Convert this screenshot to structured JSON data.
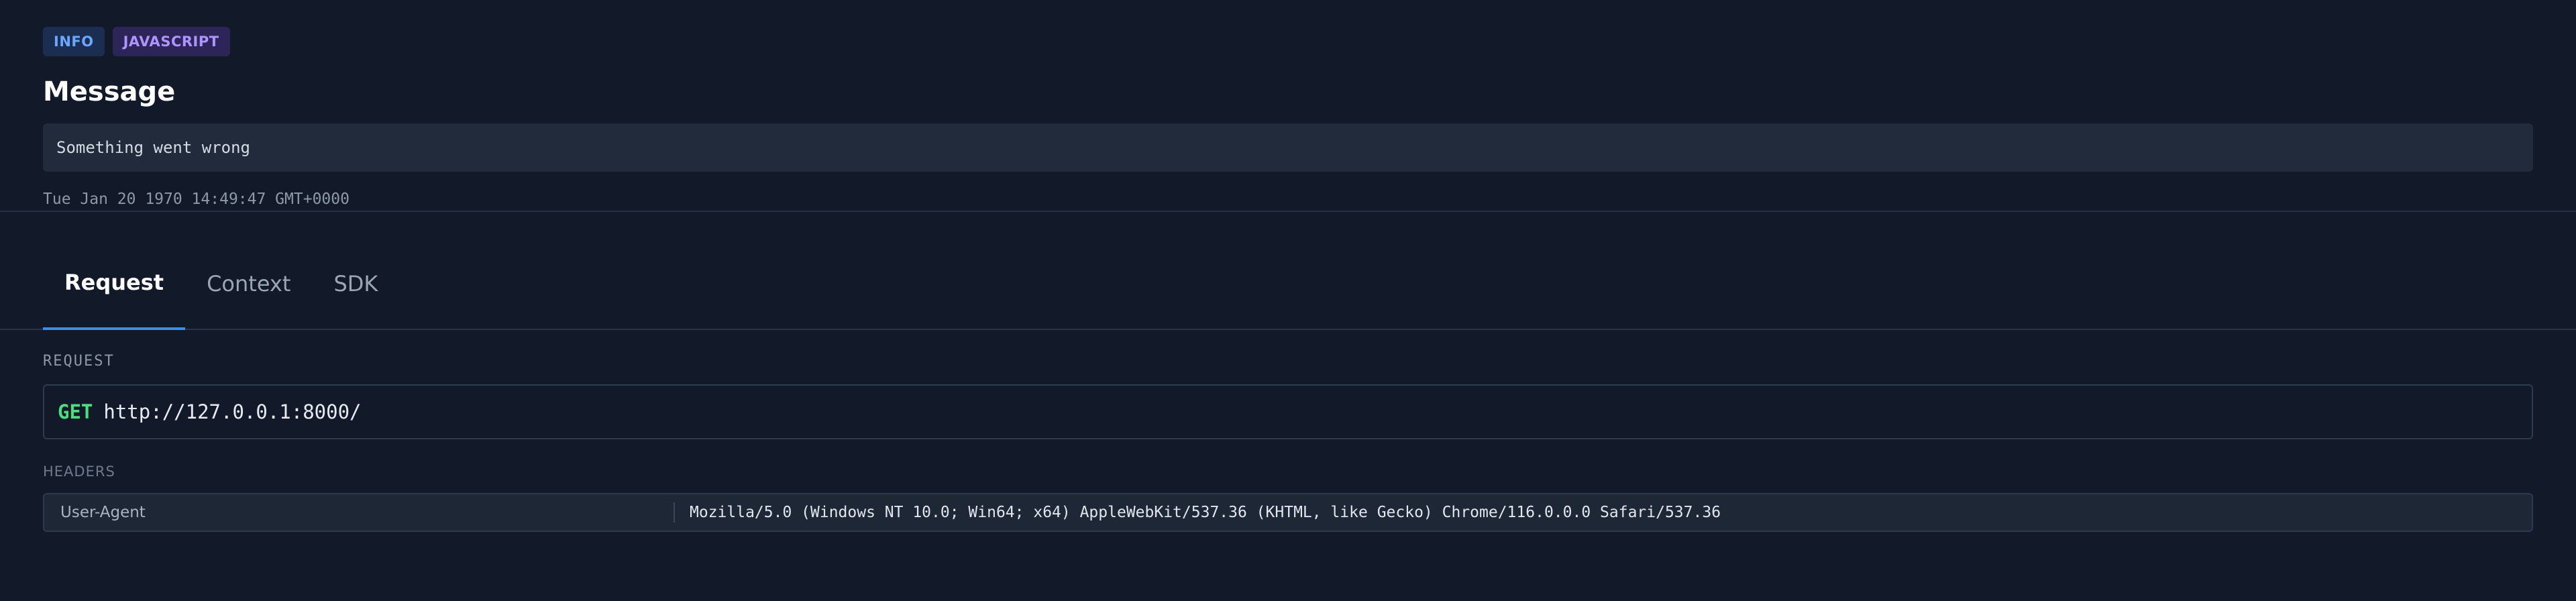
{
  "badges": {
    "level": "INFO",
    "platform": "JAVASCRIPT"
  },
  "title": "Message",
  "message": "Something went wrong",
  "timestamp": "Tue Jan 20 1970 14:49:47 GMT+0000",
  "tabs": [
    {
      "label": "Request",
      "active": true
    },
    {
      "label": "Context",
      "active": false
    },
    {
      "label": "SDK",
      "active": false
    }
  ],
  "request": {
    "section_label": "REQUEST",
    "method": "GET",
    "url": "http://127.0.0.1:8000/",
    "headers_label": "HEADERS",
    "headers": [
      {
        "key": "User-Agent",
        "value": "Mozilla/5.0 (Windows NT 10.0; Win64; x64) AppleWebKit/537.36 (KHTML, like Gecko) Chrome/116.0.0.0 Safari/537.36"
      }
    ]
  },
  "colors": {
    "background": "#121a29",
    "accent": "#3b8ee8",
    "method_green": "#4ade80",
    "info_badge": "#6aa8ff",
    "js_badge": "#ae94ff"
  }
}
